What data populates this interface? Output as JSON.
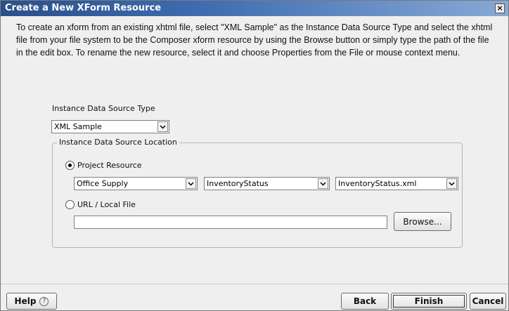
{
  "dialog": {
    "title": "Create a New XForm Resource",
    "close_glyph": "×"
  },
  "instructions": "To create an xform from an existing xhtml file, select \"XML Sample\" as the Instance Data Source Type and select the xhtml file from your file system to be the Composer xform resource by using the Browse button or simply type the path of the file in the edit box.  To rename the new resource, select it and choose Properties from the File or mouse context menu.",
  "source_type": {
    "label": "Instance Data Source Type",
    "value": "XML Sample"
  },
  "location_group": {
    "label": "Instance Data Source Location",
    "project_resource": {
      "label": "Project Resource",
      "selected": true,
      "project": "Office Supply",
      "folder": "InventoryStatus",
      "file": "InventoryStatus.xml"
    },
    "url_local": {
      "label": "URL / Local File",
      "selected": false,
      "value": "",
      "browse_label": "Browse..."
    }
  },
  "footer": {
    "help_label": "Help",
    "help_icon": "?",
    "back_label": "Back",
    "finish_label": "Finish",
    "cancel_label": "Cancel"
  },
  "icons": {
    "dropdown": "chevron-down-icon",
    "help": "question-circle-icon",
    "close": "close-icon"
  }
}
